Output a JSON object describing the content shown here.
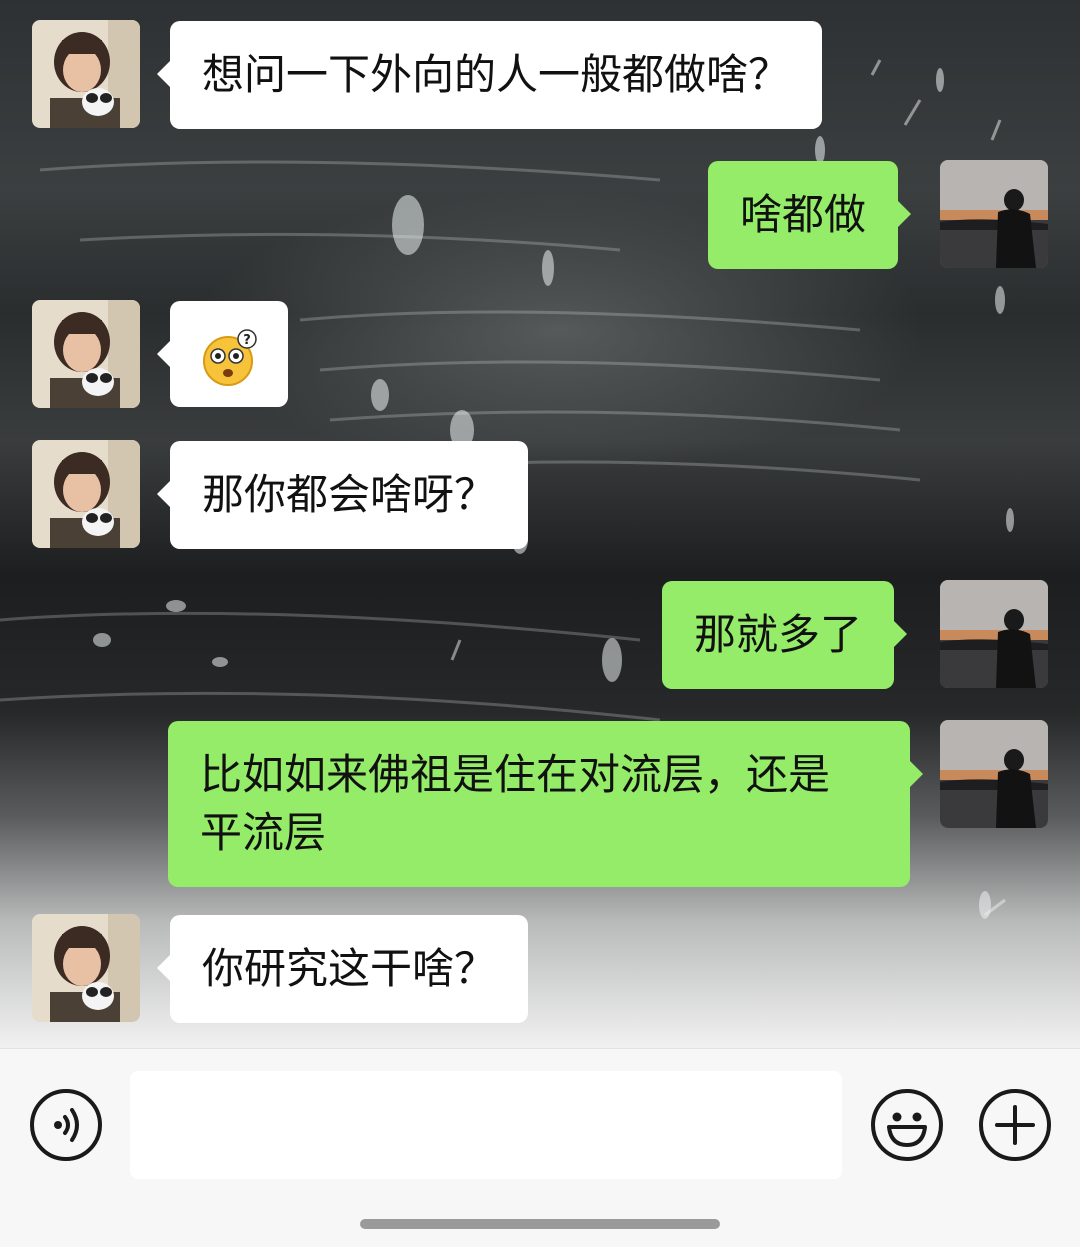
{
  "chat": {
    "messages": [
      {
        "sender": "contact",
        "text": "想问一下外向的人一般都做啥？"
      },
      {
        "sender": "me",
        "text": "啥都做"
      },
      {
        "sender": "contact",
        "sticker": "confused-emoji"
      },
      {
        "sender": "contact",
        "text": "那你都会啥呀？"
      },
      {
        "sender": "me",
        "text": "那就多了"
      },
      {
        "sender": "me",
        "lines": [
          "比如如来佛祖是住在对流层，还是",
          "平流层"
        ]
      },
      {
        "sender": "contact",
        "text": "你研究这干啥？"
      }
    ]
  },
  "input_bar": {
    "message_input_value": "",
    "voice_icon": "voice-icon",
    "emoji_icon": "emoji-icon",
    "add_icon": "add-icon"
  },
  "colors": {
    "outgoing_bubble": "#95ec69",
    "incoming_bubble": "#ffffff",
    "input_bar_bg": "#f7f7f7"
  }
}
